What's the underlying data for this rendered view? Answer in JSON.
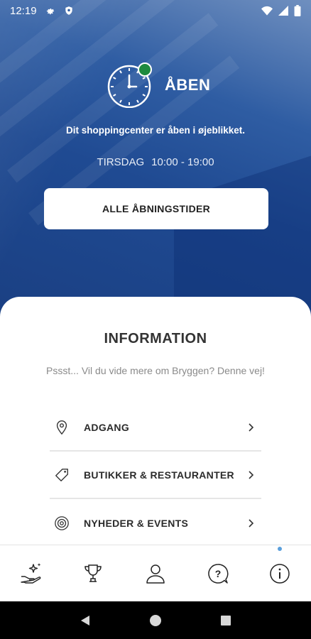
{
  "statusbar": {
    "time": "12:19"
  },
  "hero": {
    "status_label": "ÅBEN",
    "subtitle": "Dit shoppingcenter er åben i øjeblikket.",
    "day": "TIRSDAG",
    "hours": "10:00 - 19:00",
    "button_label": "ALLE ÅBNINGSTIDER",
    "open_color": "#1e8a3e"
  },
  "info": {
    "title": "INFORMATION",
    "subtitle": "Pssst... Vil du vide mere om Bryggen? Denne vej!",
    "items": [
      {
        "label": "ADGANG",
        "icon": "location-pin-icon"
      },
      {
        "label": "BUTIKKER & RESTAURANTER",
        "icon": "tag-icon"
      },
      {
        "label": "NYHEDER & EVENTS",
        "icon": "target-icon"
      }
    ]
  },
  "bottom_nav": {
    "items": [
      {
        "icon": "hand-sparkle-icon"
      },
      {
        "icon": "trophy-icon"
      },
      {
        "icon": "user-icon"
      },
      {
        "icon": "help-icon"
      },
      {
        "icon": "info-icon",
        "active": true
      }
    ],
    "active_color": "#5a9fdc"
  },
  "system_nav": {
    "buttons": [
      "back",
      "home",
      "recents"
    ]
  }
}
